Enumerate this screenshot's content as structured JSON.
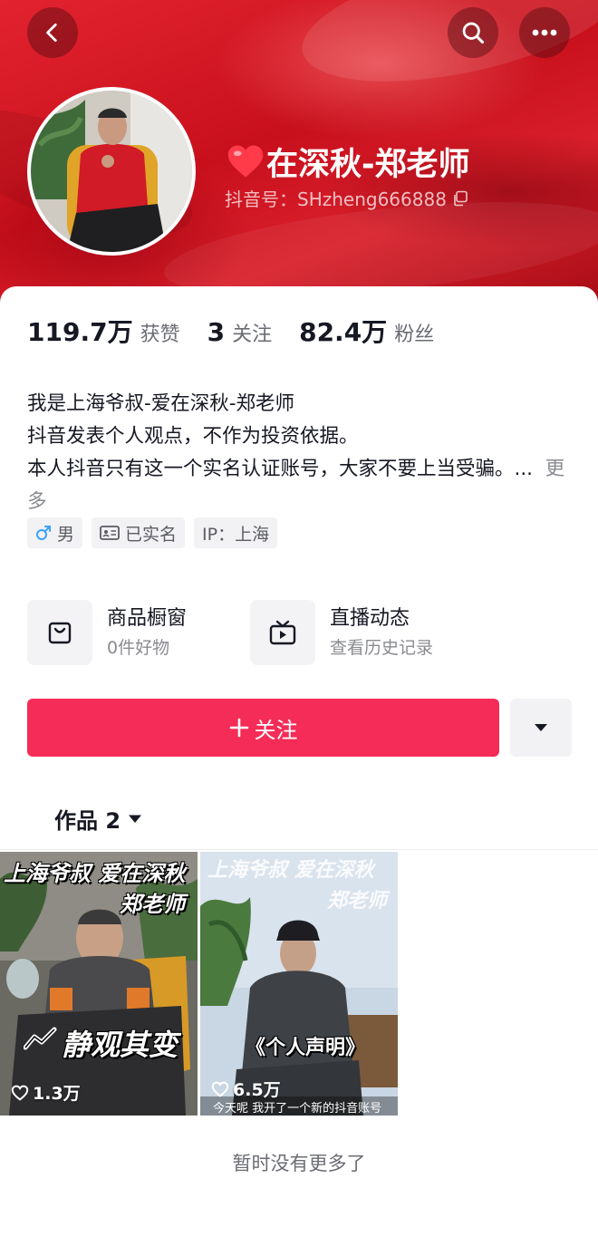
{
  "header": {
    "nickname": "在深秋-郑老师",
    "douyin_id": "抖音号：SHzheng666888",
    "heart_color": "#ff3b4a",
    "icons": [
      "back-icon",
      "search-icon",
      "more-icon",
      "copy-icon"
    ]
  },
  "stats": [
    {
      "value": "119.7万",
      "label": "获赞"
    },
    {
      "value": "3",
      "label": "关注"
    },
    {
      "value": "82.4万",
      "label": "粉丝"
    }
  ],
  "bio": {
    "lines": [
      "我是上海爷叔-爱在深秋-郑老师",
      "抖音发表个人观点，不作为投资依据。",
      "本人抖音只有这一个实名认证账号，大家不要上当受骗。..."
    ],
    "more": "更多"
  },
  "tags": [
    {
      "icon": "male-icon",
      "label": "男"
    },
    {
      "icon": "id-card-icon",
      "label": "已实名"
    },
    {
      "icon": "",
      "label": "IP：上海"
    }
  ],
  "features": [
    {
      "icon": "shopping-bag-icon",
      "title": "商品橱窗",
      "subtitle": "0件好物"
    },
    {
      "icon": "live-tv-icon",
      "title": "直播动态",
      "subtitle": "查看历史记录"
    }
  ],
  "follow_button": {
    "label": "关注",
    "color": "#f52c57"
  },
  "works_tab": {
    "label": "作品 2"
  },
  "videos": [
    {
      "caption_top_1": "上海爷叔 爱在深秋",
      "caption_top_2": "郑老师",
      "caption_mid": "静观其变",
      "likes": "1.3万"
    },
    {
      "caption_top_1": "上海爷叔 爱在深秋",
      "caption_top_2": "郑老师",
      "caption_mid": "《个人声明》",
      "subtitle": "今天呢 我开了一个新的抖音账号",
      "likes": "6.5万"
    }
  ],
  "footer": {
    "end_text": "暂时没有更多了"
  }
}
